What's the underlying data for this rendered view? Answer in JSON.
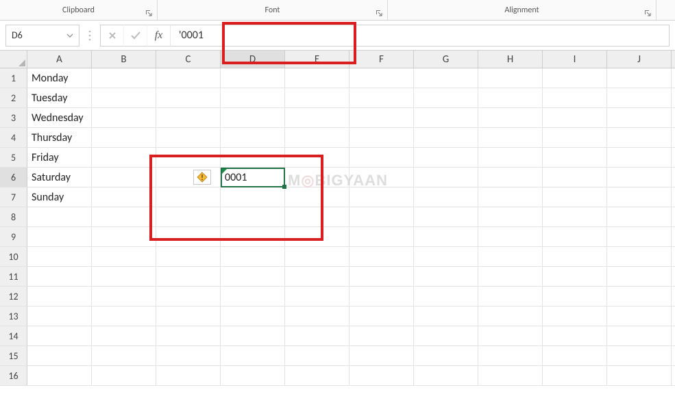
{
  "ribbon": {
    "groups": [
      {
        "label": "Clipboard"
      },
      {
        "label": "Font"
      },
      {
        "label": "Alignment"
      }
    ]
  },
  "name_box": {
    "value": "D6"
  },
  "formula_bar": {
    "cancel_icon": "✕",
    "enter_icon": "✓",
    "fx_label": "fx",
    "value": "'0001"
  },
  "columns": [
    "A",
    "B",
    "C",
    "D",
    "E",
    "F",
    "G",
    "H",
    "I",
    "J"
  ],
  "active_column": "D",
  "rows": [
    1,
    2,
    3,
    4,
    5,
    6,
    7,
    8,
    9,
    10,
    11,
    12,
    13,
    14,
    15,
    16
  ],
  "active_row": 6,
  "cells": {
    "A1": "Monday",
    "A2": "Tuesday",
    "A3": "Wednesday",
    "A4": "Thursday",
    "A5": "Friday",
    "A6": "Saturday",
    "A7": "Sunday",
    "D6": "0001"
  },
  "watermark": {
    "text_pre": "M",
    "text_mid": "BIG",
    "text_post": "YAAN"
  }
}
